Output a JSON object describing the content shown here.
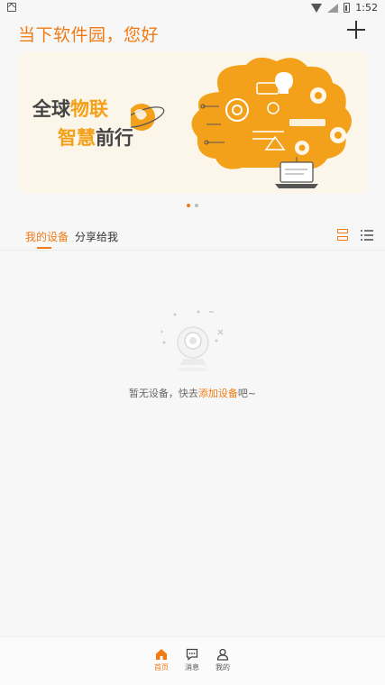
{
  "status_bar": {
    "time": "1:52"
  },
  "header": {
    "title": "当下软件园，您好"
  },
  "banner": {
    "line1_plain": "全球",
    "line1_highlight": "物联",
    "line2_highlight": "智慧",
    "line2_plain": "前行",
    "page_count": 2,
    "active_page": 1
  },
  "tabs": [
    {
      "label": "我的设备",
      "active": true
    },
    {
      "label": "分享给我",
      "active": false
    }
  ],
  "empty_state": {
    "text_before": "暂无设备，快去",
    "link_text": "添加设备",
    "text_after": "吧~"
  },
  "bottom_nav": [
    {
      "label": "首页",
      "icon": "home-icon",
      "active": true
    },
    {
      "label": "消息",
      "icon": "message-icon",
      "active": false
    },
    {
      "label": "我的",
      "icon": "profile-icon",
      "active": false
    }
  ],
  "colors": {
    "accent": "#f07b14",
    "banner_bg": "#fcf6ea",
    "banner_highlight": "#f3a11a"
  }
}
